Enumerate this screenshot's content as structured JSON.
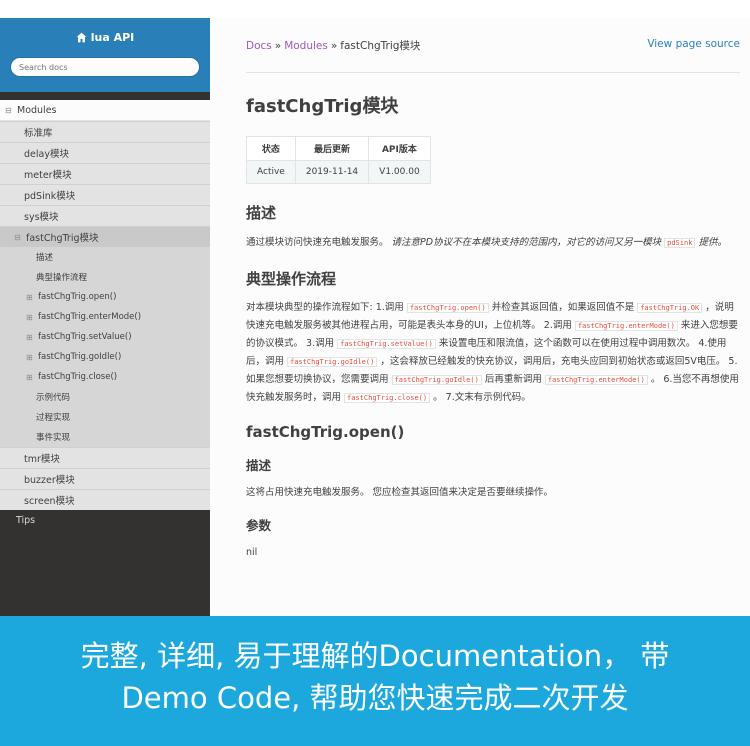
{
  "sidebar": {
    "brand": "lua API",
    "search_placeholder": "Search docs",
    "modules_label": "Modules",
    "items": [
      {
        "label": "标准库"
      },
      {
        "label": "delay模块"
      },
      {
        "label": "meter模块"
      },
      {
        "label": "pdSink模块"
      },
      {
        "label": "sys模块"
      }
    ],
    "current": {
      "label": "fastChgTrig模块",
      "children": [
        {
          "label": "描述",
          "expandable": false
        },
        {
          "label": "典型操作流程",
          "expandable": false
        },
        {
          "label": "fastChgTrig.open()",
          "expandable": true
        },
        {
          "label": "fastChgTrig.enterMode()",
          "expandable": true
        },
        {
          "label": "fastChgTrig.setValue()",
          "expandable": true
        },
        {
          "label": "fastChgTrig.goIdle()",
          "expandable": true
        },
        {
          "label": "fastChgTrig.close()",
          "expandable": true
        },
        {
          "label": "示例代码",
          "expandable": false
        },
        {
          "label": "过程实现",
          "expandable": false
        },
        {
          "label": "事件实现",
          "expandable": false
        }
      ]
    },
    "items_after": [
      {
        "label": "tmr模块"
      },
      {
        "label": "buzzer模块"
      },
      {
        "label": "screen模块"
      }
    ],
    "tips": "Tips"
  },
  "breadcrumbs": {
    "docs": "Docs",
    "sep": "»",
    "modules": "Modules",
    "current": "fastChgTrig模块",
    "view_source": "View page source"
  },
  "page": {
    "title": "fastChgTrig模块",
    "table": {
      "headers": [
        "状态",
        "最后更新",
        "API版本"
      ],
      "row": [
        "Active",
        "2019-11-14",
        "V1.00.00"
      ]
    },
    "desc_heading": "描述",
    "desc_text": "通过模块访问快速充电触发服务。",
    "desc_em": "请注意PD协议不在本模块支持的范围内，对它的访问又另一模块",
    "desc_code": "pdSink",
    "desc_em_end": "提供。",
    "flow_heading": "典型操作流程",
    "flow": {
      "t1": "对本模块典型的操作流程如下: 1.调用 ",
      "c1": "fastChgTrig.open()",
      "t2": " 并检查其返回值，如果返回值不是 ",
      "c2": "fastChgTrig.OK",
      "t3": " ，说明快速充电触发服务被其他进程占用，可能是表头本身的UI，上位机等。 2.调用 ",
      "c3": "fastChgTrig.enterMode()",
      "t4": " 来进入您想要的协议模式。 3.调用 ",
      "c4": "fastChgTrig.setValue()",
      "t5": " 来设置电压和限流值，这个函数可以在使用过程中调用数次。 4.使用后，调用 ",
      "c5": "fastChgTrig.goIdle()",
      "t6": " ，这会释放已经触发的快充协议，调用后，充电头应回到初始状态或返回5V电压。 5.如果您想要切换协议，您需要调用 ",
      "c6": "fastChgTrig.goIdle()",
      "t7": " 后再重新调用 ",
      "c7": "fastChgTrig.enterMode()",
      "t8": " 。 6.当您不再想使用快充触发服务时，调用 ",
      "c8": "fastChgTrig.close()",
      "t9": " 。 7.文末有示例代码。"
    },
    "open_heading": "fastChgTrig.open()",
    "open_desc_heading": "描述",
    "open_desc_text": "这将占用快速充电触发服务。 您应检查其返回值来决定是否要继续操作。",
    "params_heading": "参数",
    "params_text": "nil"
  },
  "banner": {
    "line1": "完整, 详细, 易于理解的Documentation， 带",
    "line2": "Demo Code, 帮助您快速完成二次开发"
  },
  "colors": {
    "sidebar_top": "#2980b9",
    "sidebar_bg": "#343131",
    "link_purple": "#9b59b6",
    "link_blue": "#2980b9",
    "code_red": "#e74c3c",
    "banner": "#1ca8dd"
  }
}
